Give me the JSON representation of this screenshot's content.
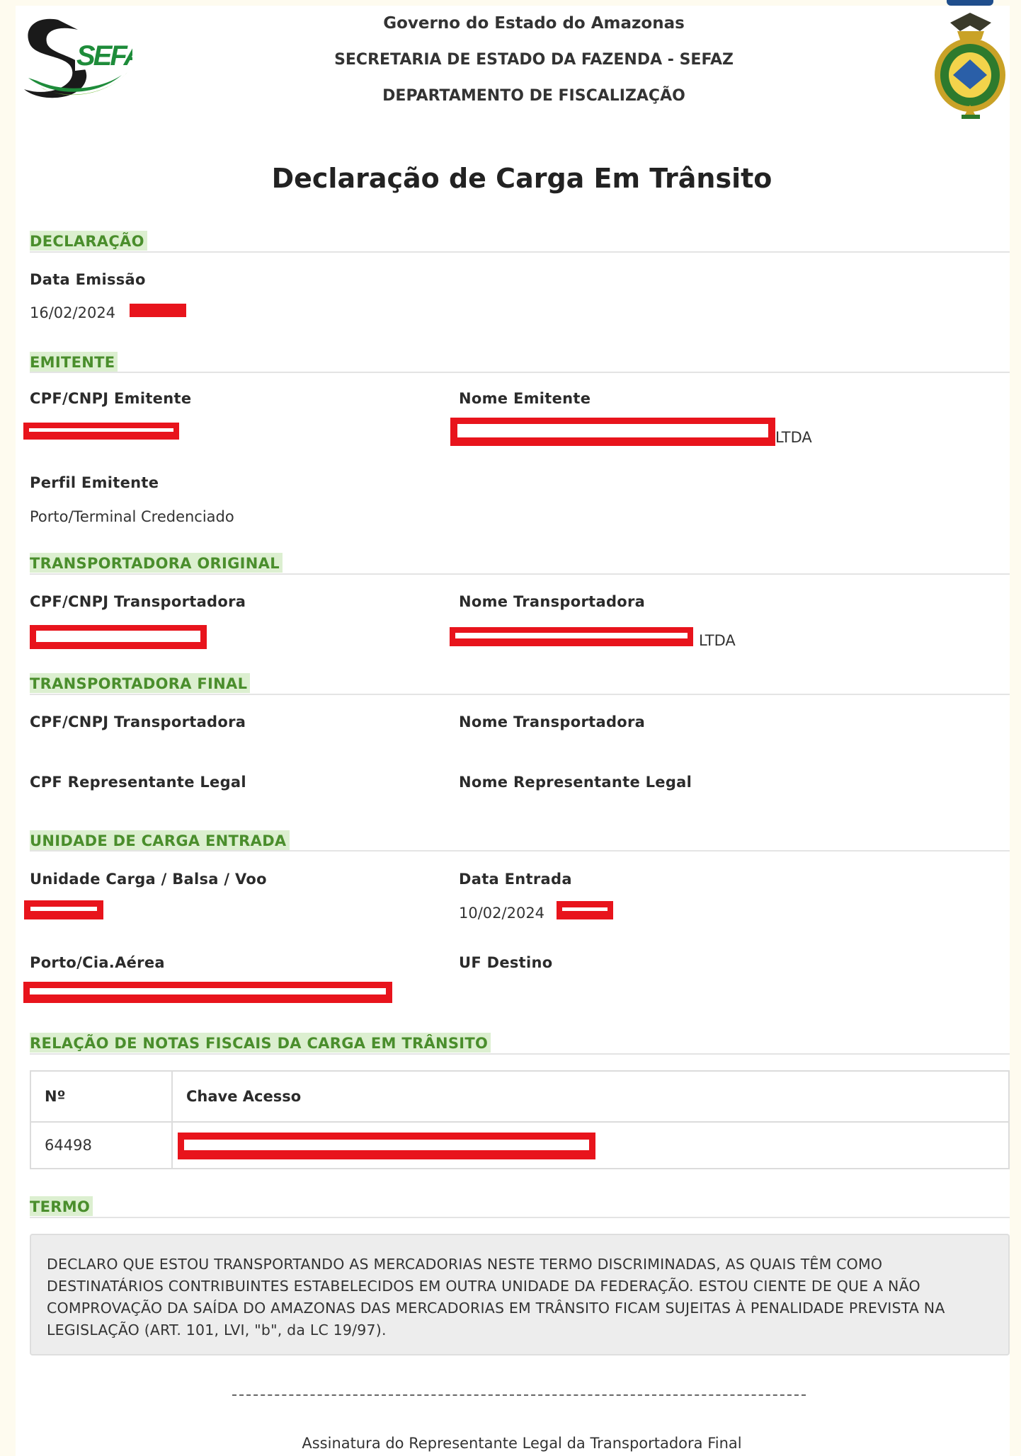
{
  "header": {
    "logo_text": "SEFAZ",
    "line1": "Governo do Estado do Amazonas",
    "line2": "SECRETARIA DE ESTADO DA FAZENDA - SEFAZ",
    "line3": "DEPARTAMENTO DE FISCALIZAÇÃO"
  },
  "title": "Declaração de Carga Em Trânsito",
  "declaracao": {
    "section": "DECLARAÇÃO",
    "data_emissao_label": "Data Emissão",
    "data_emissao_value": "16/02/2024"
  },
  "emitente": {
    "section": "EMITENTE",
    "cpf_label": "CPF/CNPJ Emitente",
    "nome_label": "Nome Emitente",
    "nome_suffix": "LTDA",
    "perfil_label": "Perfil Emitente",
    "perfil_value": "Porto/Terminal Credenciado"
  },
  "transp_original": {
    "section": "TRANSPORTADORA ORIGINAL",
    "cpf_label": "CPF/CNPJ Transportadora",
    "nome_label": "Nome Transportadora",
    "nome_suffix": "LTDA"
  },
  "transp_final": {
    "section": "TRANSPORTADORA FINAL",
    "cpf_label": "CPF/CNPJ Transportadora",
    "nome_label": "Nome Transportadora",
    "rep_cpf_label": "CPF Representante Legal",
    "rep_nome_label": "Nome Representante Legal"
  },
  "unidade": {
    "section": "UNIDADE DE CARGA ENTRADA",
    "unidade_label": "Unidade Carga / Balsa / Voo",
    "data_label": "Data Entrada",
    "data_value": "10/02/2024",
    "porto_label": "Porto/Cia.Aérea",
    "uf_label": "UF Destino"
  },
  "notas": {
    "section": "RELAÇÃO DE NOTAS FISCAIS DA CARGA EM TRÂNSITO",
    "col_numero": "Nº",
    "col_chave": "Chave Acesso",
    "rows": [
      {
        "numero": "64498"
      }
    ]
  },
  "termo": {
    "section": "TERMO",
    "text": "DECLARO QUE ESTOU TRANSPORTANDO AS MERCADORIAS NESTE TERMO DISCRIMINADAS, AS QUAIS TÊM COMO DESTINATÁRIOS CONTRIBUINTES ESTABELECIDOS EM OUTRA UNIDADE DA FEDERAÇÃO. ESTOU CIENTE DE QUE A NÃO COMPROVAÇÃO DA SAÍDA DO AMAZONAS DAS MERCADORIAS EM TRÂNSITO FICAM SUJEITAS À PENALIDADE PREVISTA NA LEGISLAÇÃO (ART. 101, LVI, \"b\", da LC 19/97)."
  },
  "signature": {
    "label": "Assinatura do Representante Legal da Transportadora Final"
  },
  "colors": {
    "section_text": "#4a8e2c",
    "section_bg": "#dcefd0",
    "redaction": "#e8141c"
  }
}
